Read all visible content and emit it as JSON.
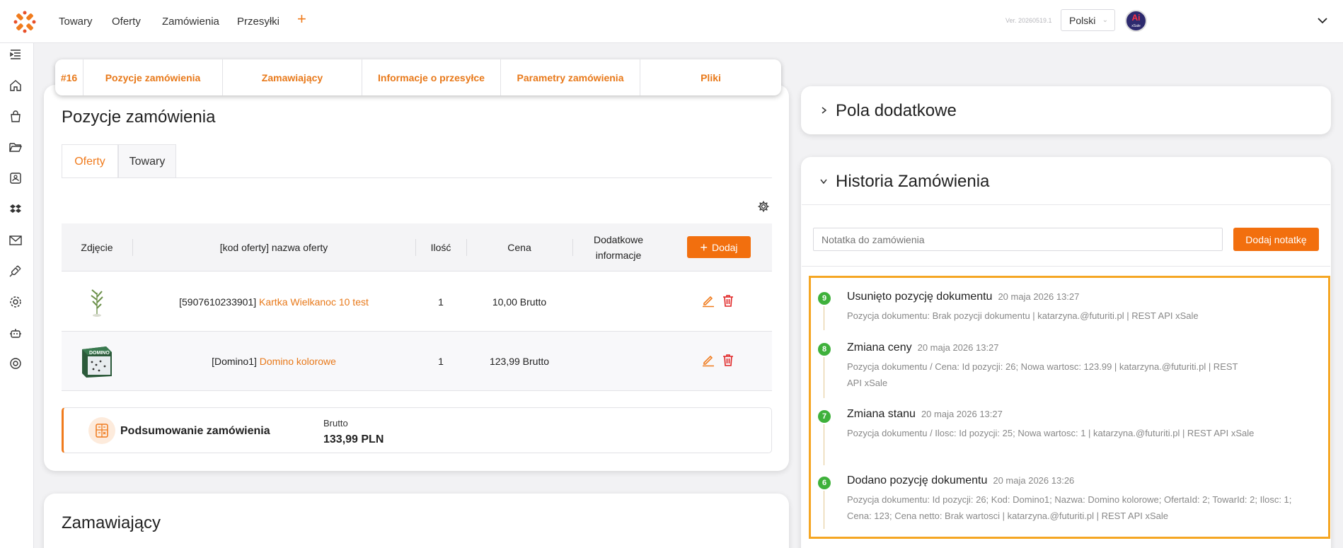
{
  "header": {
    "nav": [
      "Towary",
      "Oferty",
      "Zamówienia",
      "Przesyłki"
    ],
    "plus": "+",
    "version": "Ver. 20260519.1",
    "language": "Polski",
    "avatar_main": "Ai",
    "avatar_sub": "xSale"
  },
  "order_tabs": [
    {
      "label": "#16"
    },
    {
      "label": "Pozycje zamówienia"
    },
    {
      "label": "Zamawiający"
    },
    {
      "label": "Informacje o przesyłce"
    },
    {
      "label": "Parametry zamówienia"
    },
    {
      "label": "Pliki"
    }
  ],
  "positions": {
    "title": "Pozycje zamówienia",
    "subtabs": [
      "Oferty",
      "Towary"
    ],
    "columns": [
      "Zdjęcie",
      "[kod oferty] nazwa oferty",
      "Ilość",
      "Cena",
      "Dodatkowe informacje"
    ],
    "add_label": "Dodaj",
    "rows": [
      {
        "code": "[5907610233901]",
        "name": "Kartka Wielkanoc 10 test",
        "qty": "1",
        "price": "10,00 Brutto",
        "image_icon": "easter-card-icon"
      },
      {
        "code": "[Domino1]",
        "name": "Domino kolorowe",
        "qty": "1",
        "price": "123,99 Brutto",
        "image_icon": "domino-box-icon"
      }
    ],
    "summary": {
      "title": "Podsumowanie zamówienia",
      "label": "Brutto",
      "value": "133,99 PLN"
    }
  },
  "orderer": {
    "title": "Zamawiający"
  },
  "extra_fields": {
    "title": "Pola dodatkowe"
  },
  "history": {
    "title": "Historia Zamówienia",
    "note_placeholder": "Notatka do zamówienia",
    "note_button": "Dodaj notatkę",
    "entries": [
      {
        "num": "9",
        "title": "Usunięto pozycję dokumentu",
        "time": "20 maja 2026 13:27",
        "desc1": "Pozycja dokumentu: Brak pozycji dokumentu | katarzyna.@futuriti.pl | REST API xSale",
        "desc2": ""
      },
      {
        "num": "8",
        "title": "Zmiana ceny",
        "time": "20 maja 2026 13:27",
        "desc1": "Pozycja dokumentu / Cena: Id pozycji: 26; Nowa wartosc: 123.99 | katarzyna.@futuriti.pl | REST",
        "desc2": "API xSale"
      },
      {
        "num": "7",
        "title": "Zmiana stanu",
        "time": "20 maja 2026 13:27",
        "desc1": "Pozycja dokumentu / Ilosc: Id pozycji: 25; Nowa wartosc: 1 | katarzyna.@futuriti.pl | REST API  xSale",
        "desc2": ""
      },
      {
        "num": "6",
        "title": "Dodano pozycję dokumentu",
        "time": "20 maja 2026 13:26",
        "desc1": "Pozycja dokumentu: Id pozycji: 26; Kod: Domino1; Nazwa: Domino kolorowe; OfertaId: 2; TowarId: 2; Ilosc: 1;",
        "desc2": "Cena: 123; Cena netto: Brak wartosci | katarzyna.@futuriti.pl | REST API xSale"
      }
    ]
  },
  "colors": {
    "accent": "#f26f0e",
    "accent_text": "#e8791a",
    "highlight": "#f5a623",
    "badge": "#3fb13b"
  }
}
